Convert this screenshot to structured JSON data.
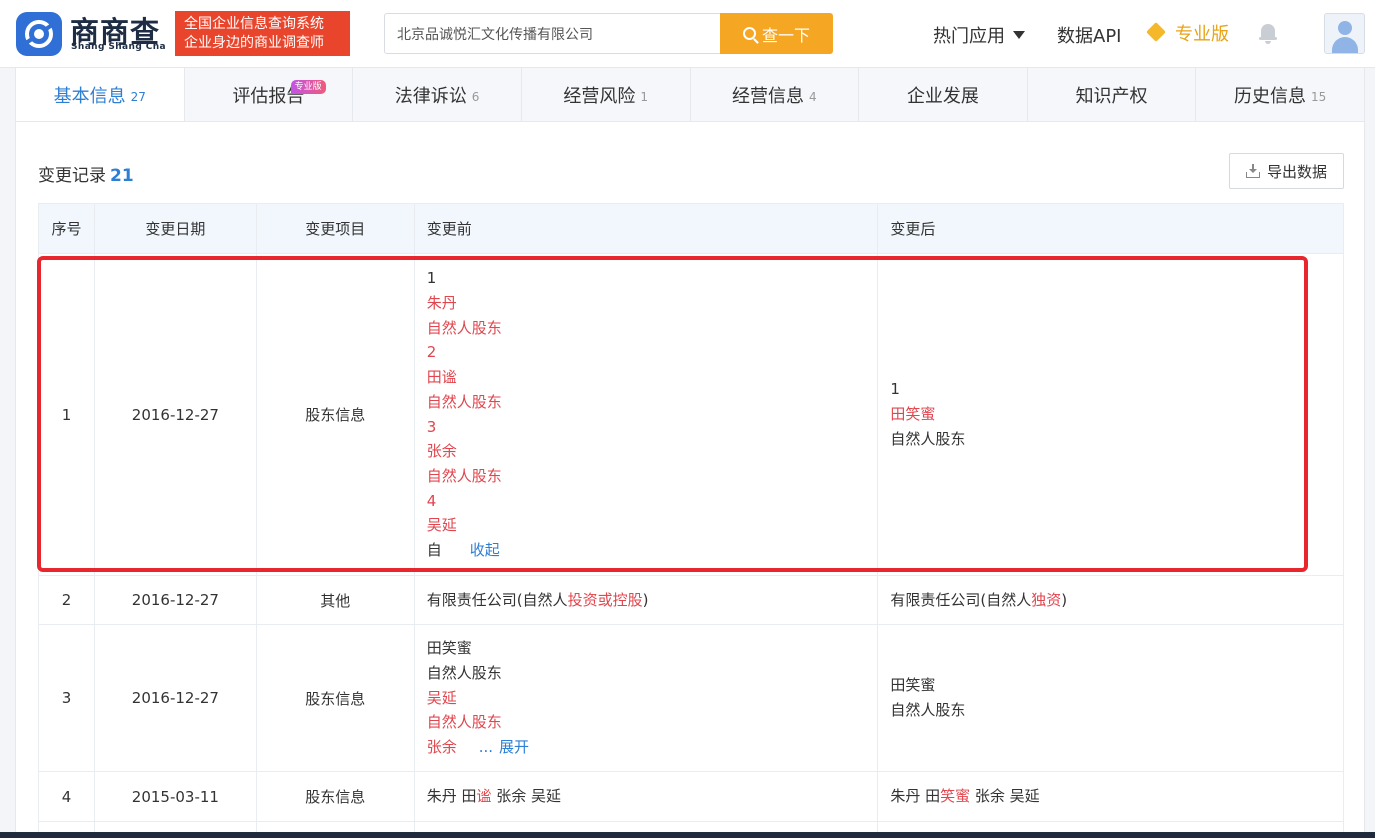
{
  "header": {
    "brand_cn": "商商查",
    "brand_en": "Shang Shang Cha",
    "slogan_line1": "全国企业信息查询系统",
    "slogan_line2": "企业身边的商业调查师",
    "search_value": "北京品诚悦汇文化传播有限公司",
    "search_button": "查一下",
    "nav_hot": "热门应用",
    "nav_api": "数据API",
    "nav_pro": "专业版"
  },
  "tabs": [
    {
      "label": "基本信息",
      "count": "27",
      "active": true
    },
    {
      "label": "评估报告",
      "count": "",
      "badge": "专业版"
    },
    {
      "label": "法律诉讼",
      "count": "6"
    },
    {
      "label": "经营风险",
      "count": "1"
    },
    {
      "label": "经营信息",
      "count": "4"
    },
    {
      "label": "企业发展",
      "count": ""
    },
    {
      "label": "知识产权",
      "count": ""
    },
    {
      "label": "历史信息",
      "count": "15"
    }
  ],
  "section": {
    "title": "变更记录",
    "count": "21",
    "export_label": "导出数据"
  },
  "table": {
    "headers": [
      "序号",
      "变更日期",
      "变更项目",
      "变更前",
      "变更后"
    ],
    "rows": [
      {
        "no": "1",
        "date": "2016-12-27",
        "item": "股东信息",
        "before": [
          "1",
          "朱丹",
          "自然人股东",
          "2",
          "田谧",
          "自然人股东",
          "3",
          "张余",
          "自然人股东",
          "4",
          "吴延",
          "自",
          "收起"
        ],
        "after": [
          "1",
          "田笑蜜",
          "自然人股东"
        ]
      },
      {
        "no": "2",
        "date": "2016-12-27",
        "item": "其他",
        "before_prefix": "有限责任公司(自然人",
        "before_highlight": "投资或控股",
        "before_suffix": ")",
        "after_prefix": "有限责任公司(自然人",
        "after_highlight": "独资",
        "after_suffix": ")"
      },
      {
        "no": "3",
        "date": "2016-12-27",
        "item": "股东信息",
        "before": [
          "田笑蜜",
          "自然人股东",
          "吴延",
          "自然人股东",
          "张余",
          "...",
          "展开"
        ],
        "after": [
          "田笑蜜",
          "自然人股东"
        ]
      },
      {
        "no": "4",
        "date": "2015-03-11",
        "item": "股东信息",
        "before_a": "朱丹 田",
        "before_highlight": "谧",
        "before_b": " 张余 吴延",
        "after_a": "朱丹 田",
        "after_highlight": "笑蜜",
        "after_b": " 张余 吴延"
      }
    ]
  },
  "colors": {
    "accent_blue": "#2d7fd3",
    "search_orange": "#f5a623",
    "change_red": "#e0464e",
    "highlight_box": "#e8262d"
  }
}
